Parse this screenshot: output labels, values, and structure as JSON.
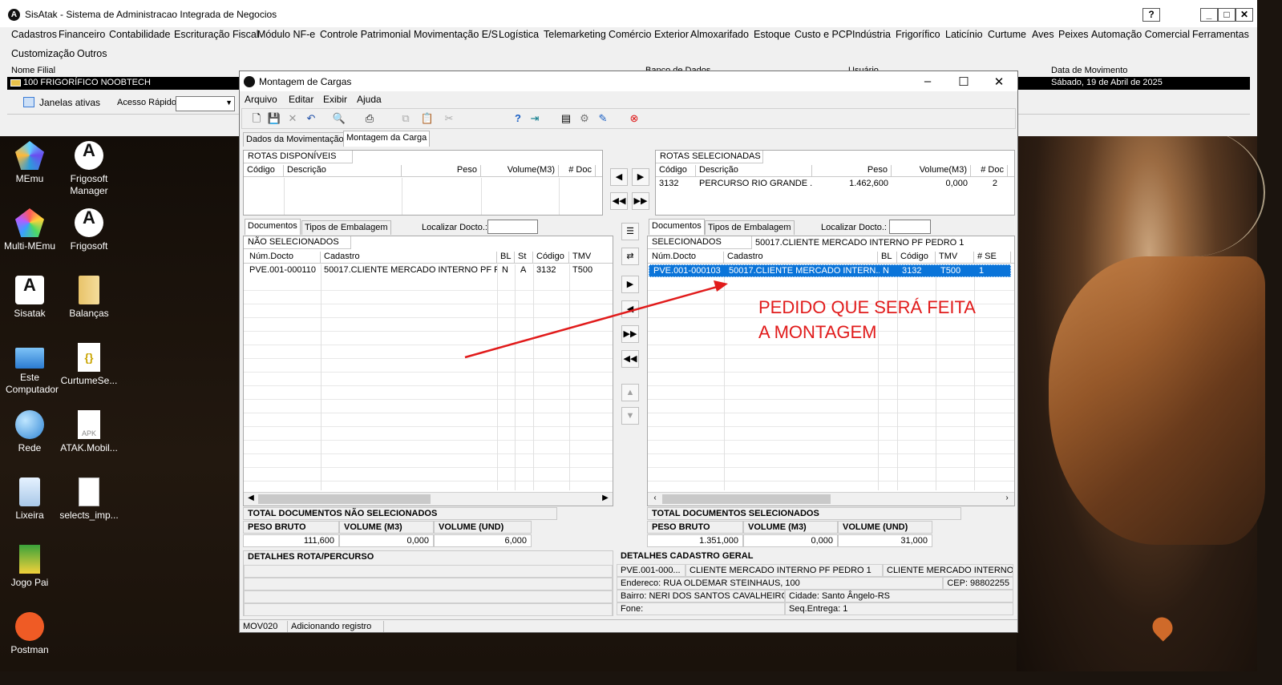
{
  "app": {
    "title": "SisAtak - Sistema de Administracao Integrada de Negocios",
    "help_btn": "?",
    "menu": [
      "Cadastros",
      "Financeiro",
      "Contabilidade",
      "Escrituração Fiscal",
      "Módulo NF-e",
      "Controle Patrimonial",
      "Movimentação E/S",
      "Logística",
      "Telemarketing",
      "Comércio Exterior",
      "Almoxarifado",
      "Estoque",
      "Custo e PCP",
      "Indústria",
      "Frigorífico",
      "Laticínio",
      "Curtume",
      "Aves",
      "Peixes",
      "Automação Comercial",
      "Ferramentas",
      "Customização",
      "Outros"
    ],
    "info_labels": {
      "filial": "Nome Filial",
      "banco": "Banco de Dados",
      "usuario": "Usuário",
      "data": "Data de Movimento"
    },
    "filial_value": "100 FRIGORÍFICO NOOBTECH",
    "data_value": "Sábado, 19 de Abril de 2025",
    "janelas_ativas": "Janelas ativas",
    "acesso_rapido": "Acesso Rápido"
  },
  "desktop_icons": [
    {
      "label": "MEmu",
      "icon": "memu-icon"
    },
    {
      "label": "Frigosoft Manager",
      "icon": "frigosoft-icon"
    },
    {
      "label": "Multi-MEmu",
      "icon": "multi-memu-icon"
    },
    {
      "label": "Frigosoft",
      "icon": "frigosoft-icon"
    },
    {
      "label": "Sisatak",
      "icon": "sisatak-icon"
    },
    {
      "label": "Balanças",
      "icon": "folder-icon"
    },
    {
      "label": "Este Computador",
      "icon": "computer-icon"
    },
    {
      "label": "CurtumeSe...",
      "icon": "json-file-icon"
    },
    {
      "label": "Rede",
      "icon": "network-icon"
    },
    {
      "label": "ATAK.Mobil...",
      "icon": "apk-file-icon"
    },
    {
      "label": "Lixeira",
      "icon": "recycle-bin-icon"
    },
    {
      "label": "selects_imp...",
      "icon": "text-file-icon"
    },
    {
      "label": "Jogo Pai",
      "icon": "game-icon"
    },
    {
      "label": "Postman",
      "icon": "postman-icon"
    }
  ],
  "dialog": {
    "title": "Montagem de Cargas",
    "menu": [
      "Arquivo",
      "Editar",
      "Exibir",
      "Ajuda"
    ],
    "tabs": [
      "Dados da Movimentação",
      "Montagem da Carga"
    ],
    "rotas_disp": {
      "title": "ROTAS DISPONÍVEIS",
      "columns": [
        "Código",
        "Descrição",
        "Peso",
        "Volume(M3)",
        "# Doc"
      ]
    },
    "rotas_sel": {
      "title": "ROTAS SELECIONADAS",
      "columns": [
        "Código",
        "Descrição",
        "Peso",
        "Volume(M3)",
        "# Doc"
      ],
      "rows": [
        [
          "3132",
          "PERCURSO RIO GRANDE ...",
          "1.462,600",
          "0,000",
          "2"
        ]
      ]
    },
    "left_tabs": [
      "Documentos",
      "Tipos de Embalagem"
    ],
    "right_tabs": [
      "Documentos",
      "Tipos de Embalagem"
    ],
    "localizar": "Localizar Docto.:",
    "nao_sel": {
      "title": "NÃO SELECIONADOS",
      "columns": [
        "Núm.Docto",
        "Cadastro",
        "BL",
        "St",
        "Código",
        "TMV"
      ],
      "rows": [
        [
          "PVE.001-000110",
          "50017.CLIENTE MERCADO INTERNO PF P...",
          "N",
          "A",
          "3132",
          "T500"
        ]
      ]
    },
    "sel": {
      "title": "SELECIONADOS",
      "subtitle": "50017.CLIENTE MERCADO INTERNO PF PEDRO 1",
      "columns": [
        "Núm.Docto",
        "Cadastro",
        "BL",
        "Código",
        "TMV",
        "# SE"
      ],
      "rows": [
        [
          "PVE.001-000103",
          "50017.CLIENTE MERCADO INTERN...",
          "N",
          "3132",
          "T500",
          "1"
        ]
      ]
    },
    "tot_nao_sel": {
      "title": "TOTAL DOCUMENTOS NÃO SELECIONADOS",
      "labels": [
        "PESO BRUTO",
        "VOLUME (M3)",
        "VOLUME (UND)"
      ],
      "values": [
        "111,600",
        "0,000",
        "6,000"
      ]
    },
    "tot_sel": {
      "title": "TOTAL DOCUMENTOS SELECIONADOS",
      "labels": [
        "PESO BRUTO",
        "VOLUME (M3)",
        "VOLUME (UND)"
      ],
      "values": [
        "1.351,000",
        "0,000",
        "31,000"
      ]
    },
    "detalhes_rota": {
      "title": "DETALHES ROTA/PERCURSO"
    },
    "detalhes_cad": {
      "title": "DETALHES CADASTRO GERAL",
      "doc": "PVE.001-000...",
      "nome": "CLIENTE MERCADO INTERNO PF PEDRO 1",
      "nome2": "CLIENTE MERCADO INTERNO PF",
      "endereco": "Endereco: RUA OLDEMAR STEINHAUS, 100",
      "cep": "CEP: 98802255",
      "bairro": "Bairro: NERI DOS SANTOS CAVALHEIRO",
      "cidade": "Cidade: Santo Ângelo-RS",
      "fone": "Fone:",
      "seq": "Seq.Entrega: 1"
    },
    "status": [
      "MOV020",
      "Adicionando registro"
    ]
  },
  "annotation": {
    "line1": "PEDIDO QUE SERÁ FEITA",
    "line2": "A MONTAGEM",
    "color": "#e11b1b"
  }
}
